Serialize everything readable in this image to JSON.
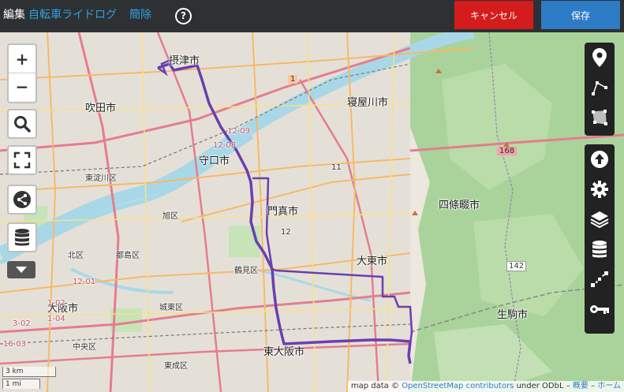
{
  "header": {
    "edit_label": "編集",
    "route_name": "自転車ライドログ",
    "delete_label": "簡除",
    "help_symbol": "?",
    "cancel_label": "キャンセル",
    "save_label": "保存"
  },
  "colors": {
    "topbar": "#2e3133",
    "link": "#2f9fe0",
    "cancel": "#d41c1c",
    "save": "#2e7bc6",
    "route": "#6a3fb0",
    "river": "#a8d8e8",
    "motorway": "#e47d8f"
  },
  "map_controls": {
    "zoom_in": "+",
    "zoom_out": "−"
  },
  "left_toolbar_icons": [
    "search-icon",
    "fullscreen-icon",
    "share-icon",
    "database-icon",
    "collapse-icon"
  ],
  "right_toolbar_icons": [
    "marker-icon",
    "polyline-icon",
    "polygon-icon",
    "upload-icon",
    "gear-icon",
    "layers-icon",
    "database-icon",
    "draw-line-icon",
    "key-icon"
  ],
  "map_labels": {
    "settsu": "摂津市",
    "neyagawa": "寝屋川市",
    "suita": "吹田市",
    "moriguchi": "守口市",
    "higashiyodogawa": "東淀川区",
    "shijonawate": "四條畷市",
    "kadoma": "門真市",
    "asahi": "旭区",
    "daito": "大東市",
    "kita": "北区",
    "miyakojima": "都島区",
    "tsurumi": "鶴見区",
    "osaka": "大阪市",
    "joto": "城東区",
    "ikoma": "生駒市",
    "chuo": "中央区",
    "higashiosaka": "東大阪市",
    "higashinari": "東成区",
    "road_1": "1",
    "road_168": "168",
    "road_142": "142",
    "road_11": "11",
    "road_12": "12",
    "km_1209": "12-09",
    "km_1208": "12-08",
    "km_1201": "12-01",
    "km_102": "1-02",
    "km_104": "1-04",
    "km_302": "3-02",
    "km_1603": "16-03"
  },
  "scale": {
    "km": "3 km",
    "mi": "1 mi"
  },
  "attribution": {
    "prefix": "map data ©",
    "osm": "OpenStreetMap",
    "contributors": "contributors",
    "odbl": "under ODbL",
    "sep": "–",
    "overview": "概要",
    "home": "ホーム"
  }
}
